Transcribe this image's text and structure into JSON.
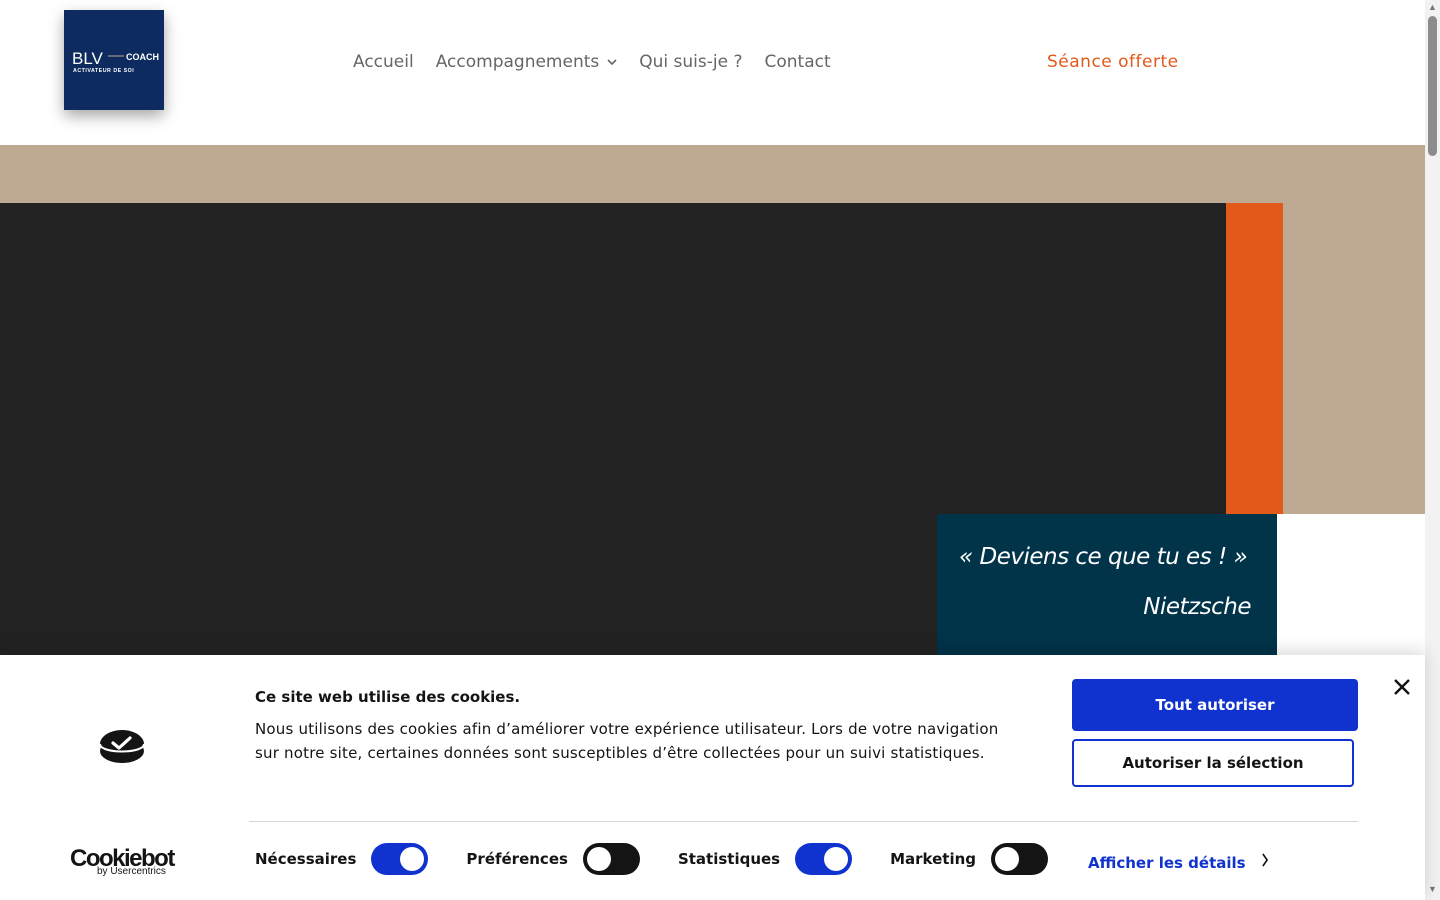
{
  "header": {
    "logo": {
      "text_main": "BLV",
      "text_coach": "COACH",
      "text_sub": "ACTIVATEUR DE SOI",
      "bg_color": "#0d2b5e"
    },
    "nav": [
      {
        "label": "Accueil"
      },
      {
        "label": "Accompagnements",
        "has_dropdown": true,
        "icon": "chevron-down-icon"
      },
      {
        "label": "Qui suis-je ?"
      },
      {
        "label": "Contact"
      }
    ],
    "cta_label": "Séance offerte",
    "cta_color": "#e2591a"
  },
  "hero": {
    "quote": "« Deviens ce que tu es ! »",
    "author": "Nietzsche",
    "colors": {
      "tan": "#bea992",
      "dark": "#222222",
      "orange": "#e2591a",
      "quote_bg": "#013349"
    }
  },
  "cookie_banner": {
    "title": "Ce site web utilise des cookies.",
    "text": "Nous utilisons des cookies afin d’améliorer votre expérience utilisateur. Lors de votre navigation sur notre site, certaines données sont susceptibles d’être collectées pour un suivi statistiques.",
    "brand": "Cookiebot",
    "brand_sub": "by Usercentrics",
    "btn_allow_all": "Tout autoriser",
    "btn_allow_selection": "Autoriser la sélection",
    "toggles": [
      {
        "label": "Nécessaires",
        "on": true
      },
      {
        "label": "Préférences",
        "on": false
      },
      {
        "label": "Statistiques",
        "on": true
      },
      {
        "label": "Marketing",
        "on": false
      }
    ],
    "details_link": "Afficher les détails",
    "accent_color": "#1032cf"
  }
}
